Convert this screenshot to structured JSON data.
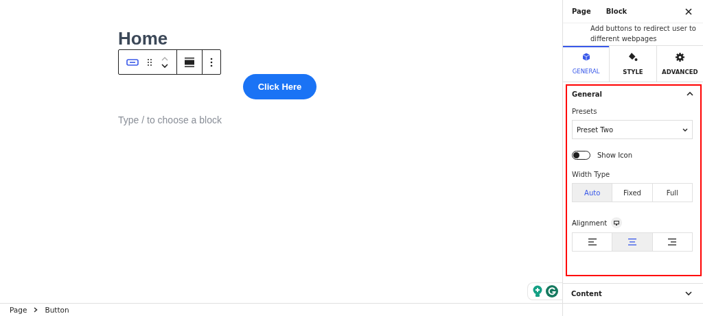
{
  "editor": {
    "heading": "Home",
    "button_label": "Click Here",
    "placeholder": "Type / to choose a block"
  },
  "sidebar": {
    "tabs": [
      "Page",
      "Block"
    ],
    "description": "Add buttons to redirect user to different webpages",
    "panel_tabs": [
      {
        "label": "GENERAL",
        "selected": true
      },
      {
        "label": "STYLE",
        "selected": false
      },
      {
        "label": "ADVANCED",
        "selected": false
      }
    ],
    "general": {
      "title": "General",
      "expanded": true,
      "highlighted": true,
      "presets_label": "Presets",
      "preset_value": "Preset Two",
      "show_icon": {
        "label": "Show Icon",
        "on": false
      },
      "width_label": "Width Type",
      "width_options": [
        {
          "label": "Auto",
          "selected": true
        },
        {
          "label": "Fixed",
          "selected": false
        },
        {
          "label": "Full",
          "selected": false
        }
      ],
      "alignment_label": "Alignment",
      "alignment_options": [
        {
          "kind": "left",
          "selected": false
        },
        {
          "kind": "center",
          "selected": true
        },
        {
          "kind": "right",
          "selected": false
        }
      ]
    },
    "content": {
      "title": "Content",
      "expanded": false
    }
  },
  "breadcrumb": [
    "Page",
    "Button"
  ]
}
